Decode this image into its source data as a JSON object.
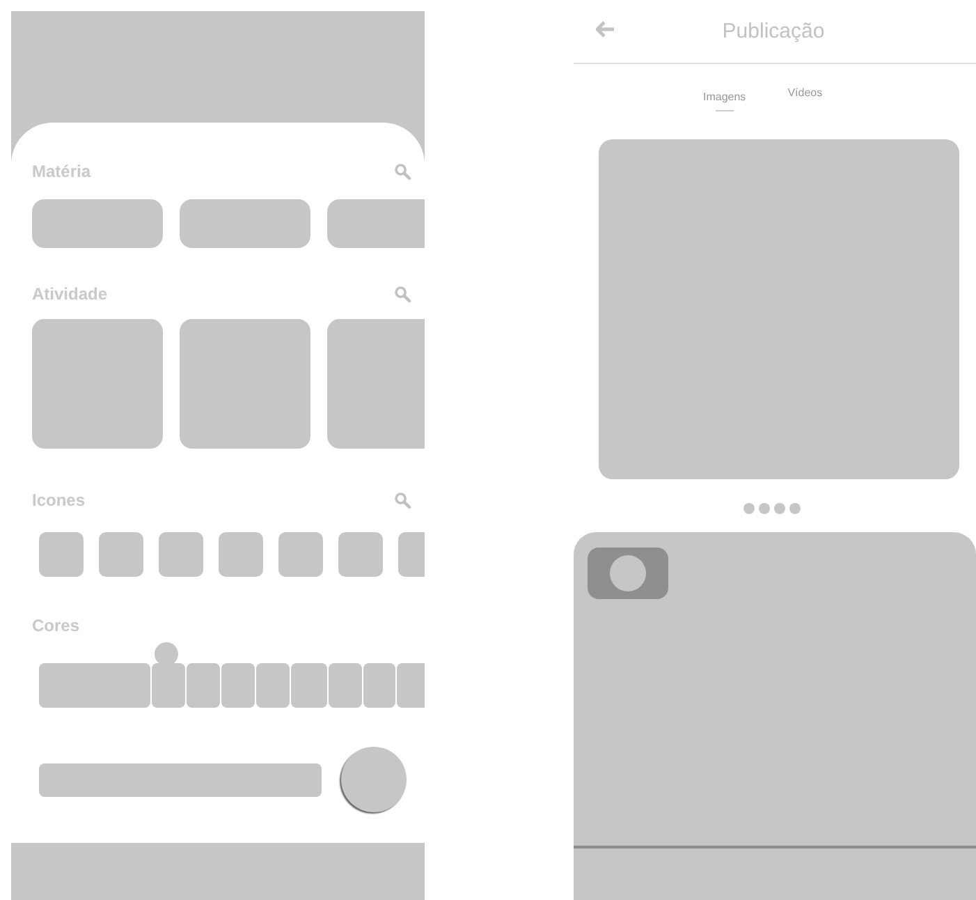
{
  "editor": {
    "sections": [
      {
        "title": "Matéria",
        "kind": "cards"
      },
      {
        "title": "Atividade",
        "kind": "tiles"
      },
      {
        "title": "Icones",
        "kind": "icons"
      }
    ],
    "colors": {
      "title": "Cores",
      "level": 0.33
    }
  },
  "publication": {
    "title": "Publicação",
    "tabs": [
      {
        "label": "Imagens",
        "selected": true
      },
      {
        "label": "Vídeos",
        "selected": false
      }
    ]
  }
}
